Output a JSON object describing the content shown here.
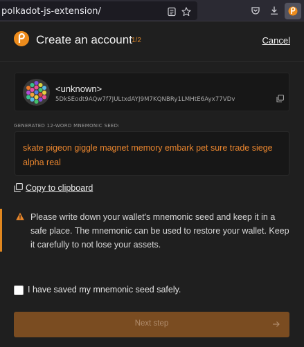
{
  "browser": {
    "url": "polkadot-js-extension/",
    "icons": [
      "reader-mode-icon",
      "bookmark-star-icon",
      "pocket-icon",
      "download-icon",
      "polkadot-extension-icon"
    ]
  },
  "header": {
    "title": "Create an account",
    "step": "1/2",
    "cancel_label": "Cancel",
    "logo_icon": "polkadot-logo-icon"
  },
  "account": {
    "name": "<unknown>",
    "address": "5DkSEodt9AQw7f7JULtxdAYJ9M7KQNBRy1LMHtE6Ayx77VDv",
    "copy_icon": "copy-icon"
  },
  "seed": {
    "label": "GENERATED 12-WORD MNEMONIC SEED:",
    "phrase": "skate pigeon giggle magnet memory embark pet sure trade siege alpha real"
  },
  "copy_clipboard": {
    "label": "Copy to clipboard",
    "icon": "copy-icon"
  },
  "warning": {
    "icon": "warning-triangle-icon",
    "text": "Please write down your wallet's mnemonic seed and keep it in a safe place. The mnemonic can be used to restore your wallet. Keep it carefully to not lose your assets."
  },
  "confirm": {
    "label": "I have saved my mnemonic seed safely.",
    "checked": false
  },
  "next": {
    "label": "Next step",
    "icon": "arrow-right-icon",
    "disabled": true
  },
  "colors": {
    "accent": "#e0871f",
    "background": "#1f1f1f",
    "button_disabled": "#7a4c21"
  }
}
